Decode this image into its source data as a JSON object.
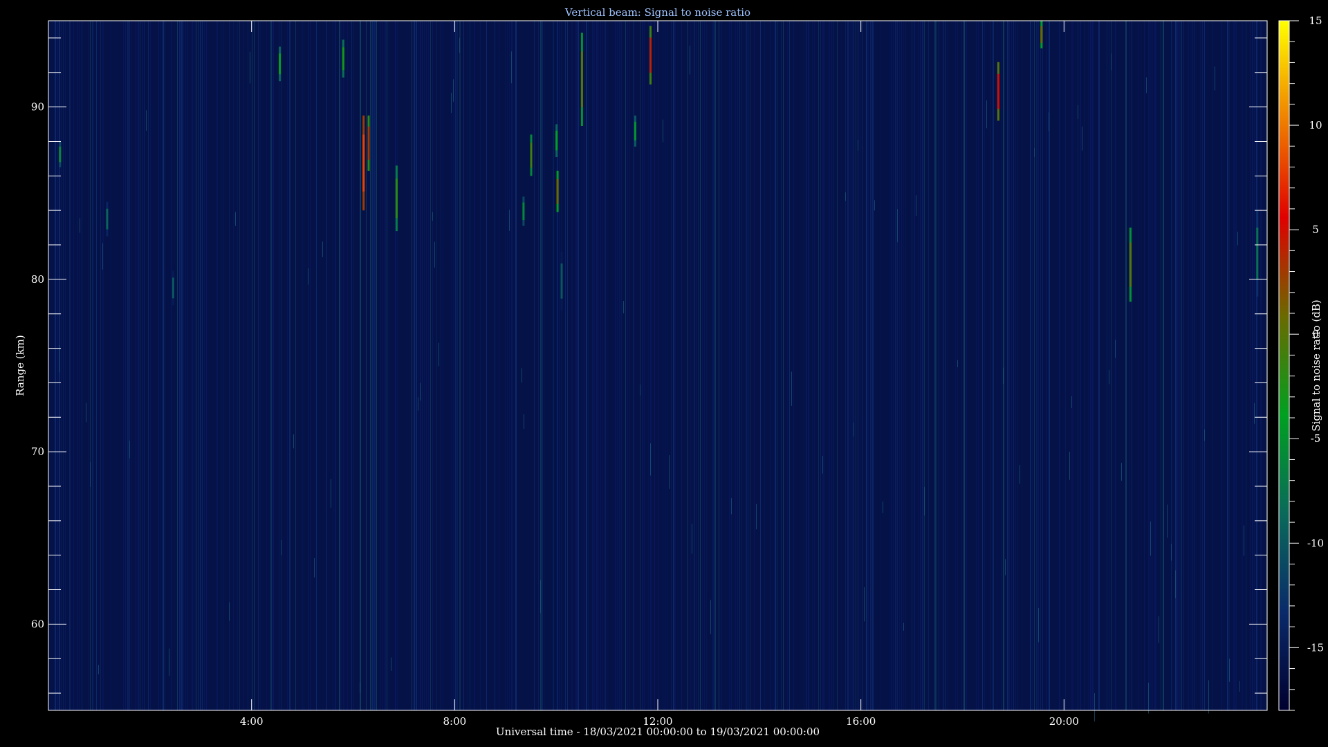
{
  "chart_data": {
    "type": "heatmap",
    "title": "Vertical beam: Signal to noise ratio",
    "xlabel": "Universal time - 18/03/2021 00:00:00 to 19/03/2021 00:00:00",
    "ylabel": "Range (km)",
    "colorbar_label": "Signal to noise ratio (dB)",
    "xlim": [
      0,
      24
    ],
    "ylim": [
      55,
      95
    ],
    "clim": [
      -18,
      15
    ],
    "x_tick_values": [
      4,
      8,
      12,
      16,
      20
    ],
    "x_tick_labels": [
      "4:00",
      "8:00",
      "12:00",
      "16:00",
      "20:00"
    ],
    "y_tick_values": [
      60,
      70,
      80,
      90
    ],
    "y_tick_labels": [
      "60",
      "70",
      "80",
      "90"
    ],
    "colorbar_tick_values": [
      -15,
      -10,
      -5,
      0,
      5,
      10,
      15
    ],
    "colorbar_tick_labels": [
      "-15",
      "-10",
      "-5",
      "0",
      "5",
      "10",
      "15"
    ],
    "background_level_db": -16,
    "colormap": [
      "#00002e",
      "#0a2a6a",
      "#0a6a5a",
      "#00a020",
      "#6a6a00",
      "#e00000",
      "#f08000",
      "#ffff00"
    ],
    "events": [
      {
        "t": 0.22,
        "r0": 86.5,
        "r1": 88.0,
        "snr": -6
      },
      {
        "t": 1.15,
        "r0": 82.5,
        "r1": 84.5,
        "snr": -9
      },
      {
        "t": 2.45,
        "r0": 78.5,
        "r1": 80.5,
        "snr": -10
      },
      {
        "t": 4.55,
        "r0": 91.5,
        "r1": 93.5,
        "snr": -4
      },
      {
        "t": 5.8,
        "r0": 91.7,
        "r1": 93.9,
        "snr": -3
      },
      {
        "t": 6.2,
        "r0": 84.0,
        "r1": 89.5,
        "snr": 8
      },
      {
        "t": 6.3,
        "r0": 86.3,
        "r1": 89.5,
        "snr": 3
      },
      {
        "t": 6.85,
        "r0": 82.8,
        "r1": 86.6,
        "snr": -2
      },
      {
        "t": 9.35,
        "r0": 83.1,
        "r1": 84.8,
        "snr": -6
      },
      {
        "t": 9.5,
        "r0": 86.0,
        "r1": 88.4,
        "snr": -1
      },
      {
        "t": 10.0,
        "r0": 87.1,
        "r1": 89.0,
        "snr": -4
      },
      {
        "t": 10.02,
        "r0": 83.9,
        "r1": 86.3,
        "snr": 1
      },
      {
        "t": 10.1,
        "r0": 78.2,
        "r1": 81.6,
        "snr": -10
      },
      {
        "t": 10.5,
        "r0": 88.9,
        "r1": 94.3,
        "snr": 0
      },
      {
        "t": 11.55,
        "r0": 87.7,
        "r1": 89.5,
        "snr": -5
      },
      {
        "t": 11.85,
        "r0": 91.3,
        "r1": 94.7,
        "snr": 4
      },
      {
        "t": 18.7,
        "r0": 89.2,
        "r1": 92.6,
        "snr": 5
      },
      {
        "t": 19.55,
        "r0": 93.4,
        "r1": 95.0,
        "snr": 1
      },
      {
        "t": 21.3,
        "r0": 78.7,
        "r1": 83.0,
        "snr": 0
      },
      {
        "t": 23.8,
        "r0": 79.0,
        "r1": 84.0,
        "snr": -8
      }
    ]
  }
}
